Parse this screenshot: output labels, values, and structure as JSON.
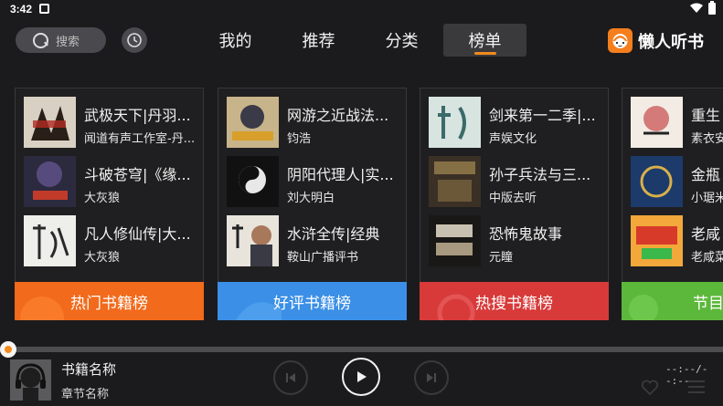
{
  "status": {
    "time": "3:42"
  },
  "search": {
    "placeholder": "搜索"
  },
  "tabs": [
    {
      "label": "我的",
      "active": false
    },
    {
      "label": "推荐",
      "active": false
    },
    {
      "label": "分类",
      "active": false
    },
    {
      "label": "榜单",
      "active": true
    }
  ],
  "brand": {
    "name": "懒人听书"
  },
  "colors": {
    "accent": "#f28b1c",
    "background": "#1b1b1d"
  },
  "cards": [
    {
      "banner": "热门书籍榜",
      "banner_color": "#f26a1b",
      "items": [
        {
          "title": "武极天下|丹羽...",
          "author": "闻道有声工作室-丹..."
        },
        {
          "title": "斗破苍穹|《缘...",
          "author": "大灰狼"
        },
        {
          "title": "凡人修仙传|大...",
          "author": "大灰狼"
        }
      ]
    },
    {
      "banner": "好评书籍榜",
      "banner_color": "#3b8fe6",
      "items": [
        {
          "title": "网游之近战法...",
          "author": "钧浩"
        },
        {
          "title": "阴阳代理人|实...",
          "author": "刘大明白"
        },
        {
          "title": "水浒全传|经典",
          "author": "鞍山广播评书"
        }
      ]
    },
    {
      "banner": "热搜书籍榜",
      "banner_color": "#d83a3a",
      "items": [
        {
          "title": "剑来第一二季|...",
          "author": "声娱文化"
        },
        {
          "title": "孙子兵法与三...",
          "author": "中版去听"
        },
        {
          "title": "恐怖鬼故事",
          "author": "元瞳"
        }
      ]
    },
    {
      "banner": "节目下",
      "banner_color": "#5cb83a",
      "items": [
        {
          "title": "重生",
          "author": "素衣安"
        },
        {
          "title": "金瓶",
          "author": "小琚米"
        },
        {
          "title": "老咸",
          "author": "老咸菜"
        }
      ]
    }
  ],
  "player": {
    "book_title": "书籍名称",
    "chapter": "章节名称",
    "time": "--:--/--:--",
    "progress": 0.0
  }
}
